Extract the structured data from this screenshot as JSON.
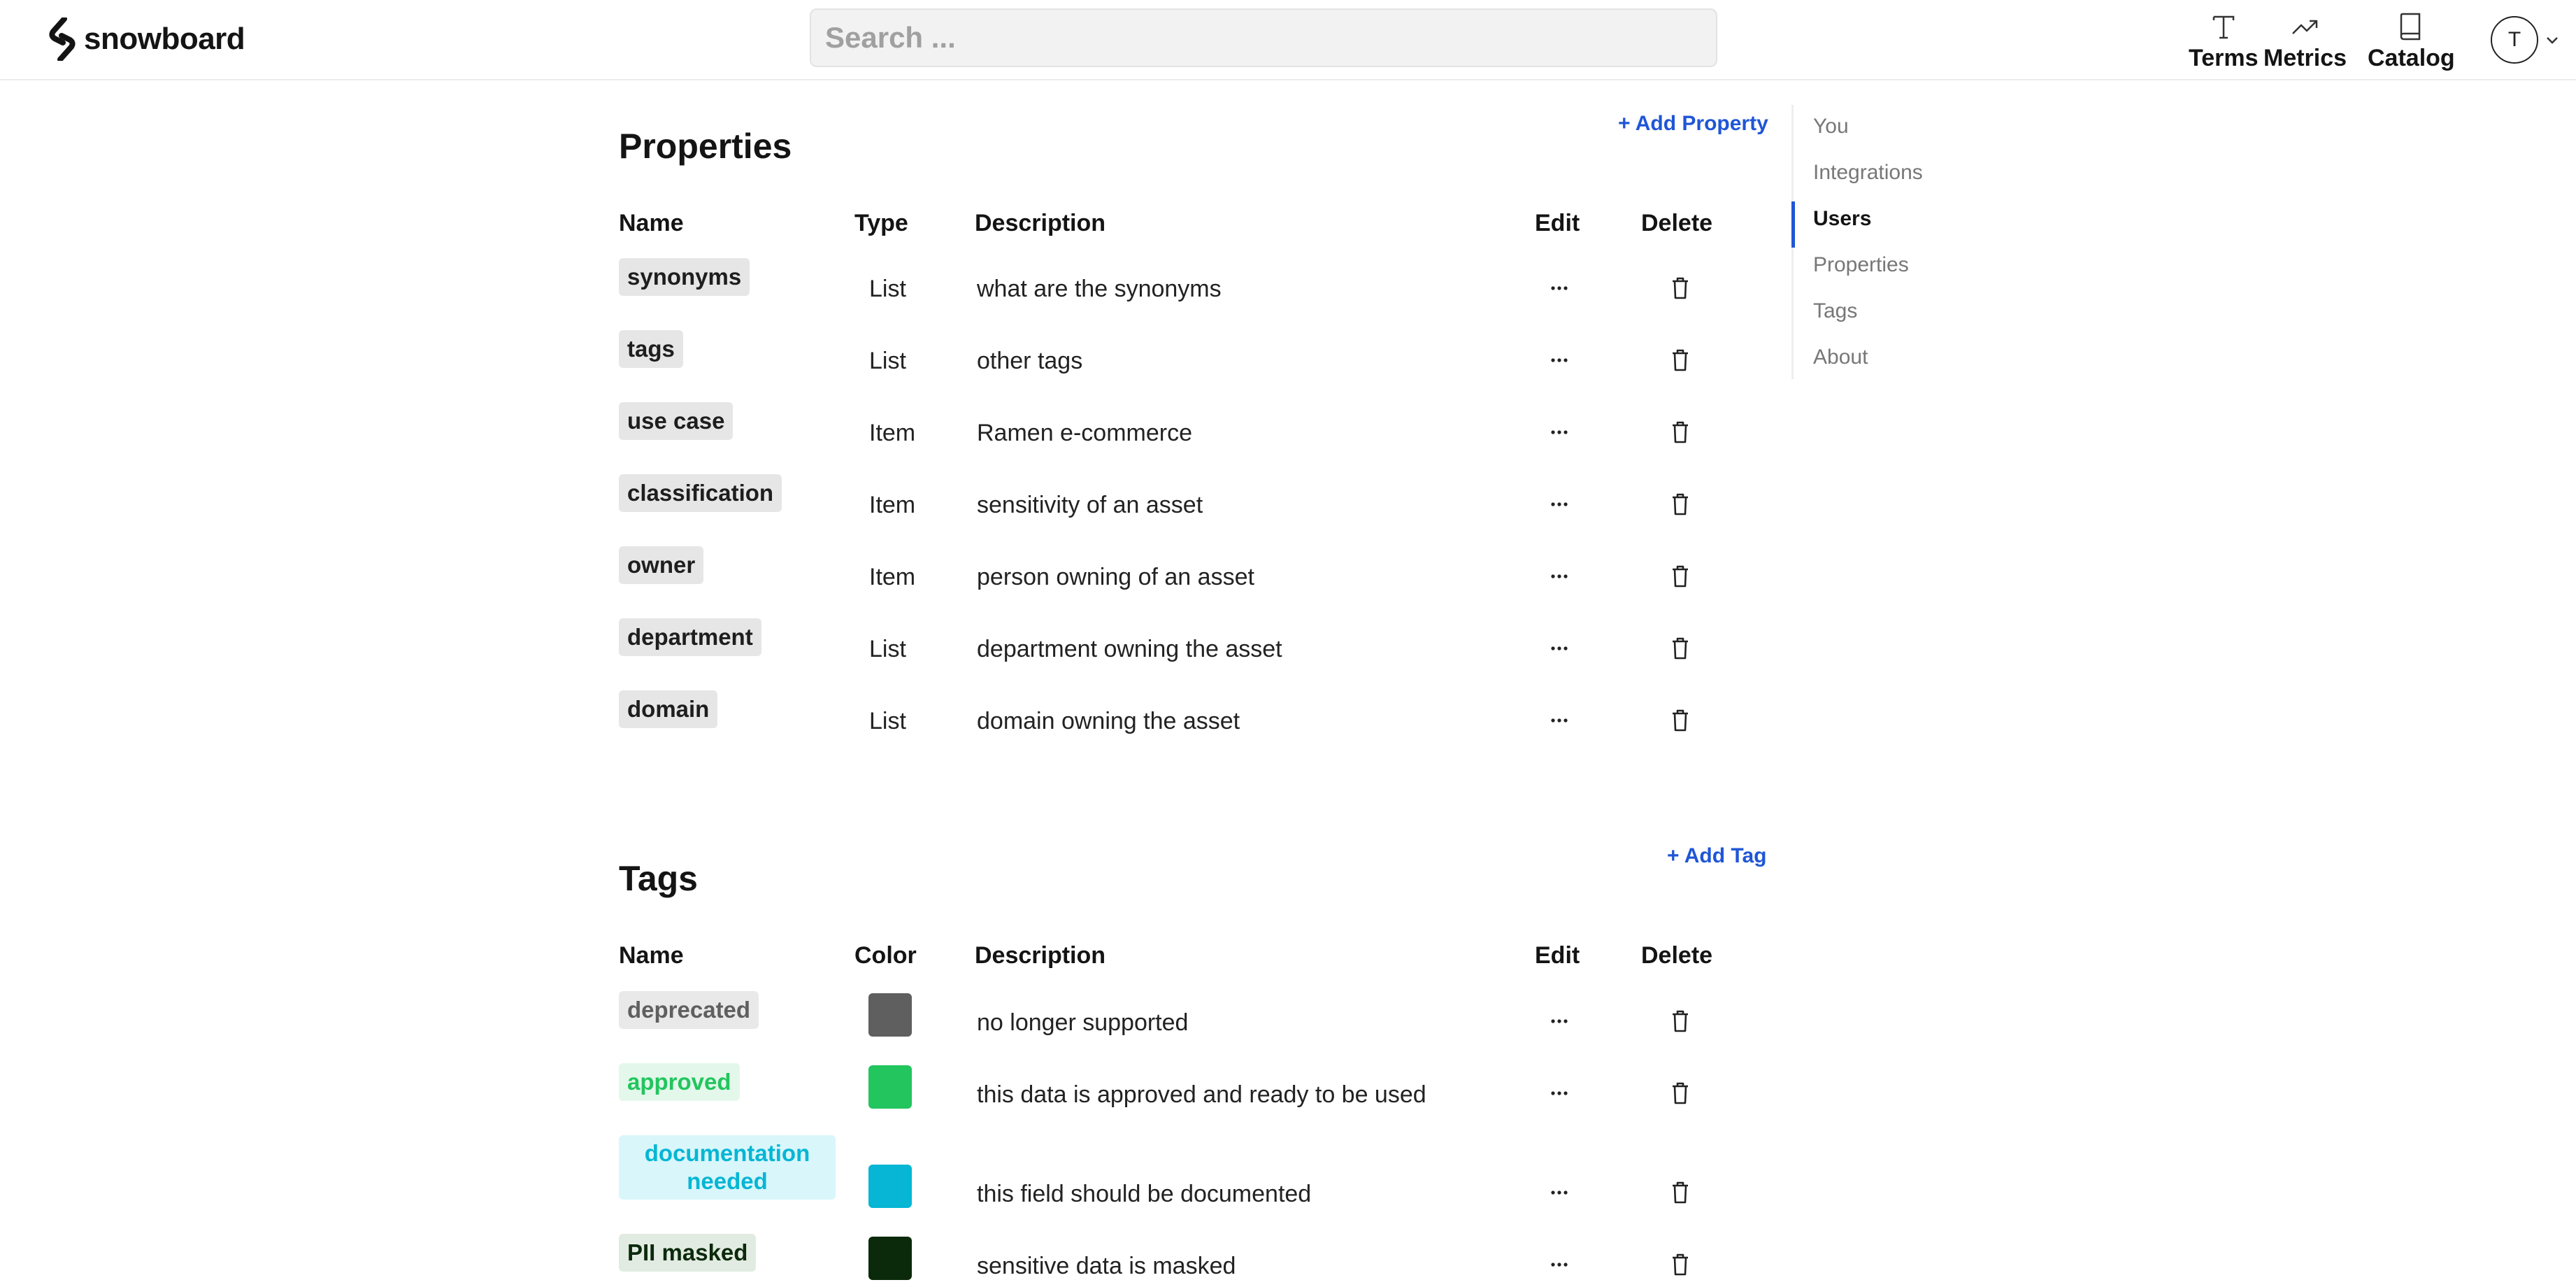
{
  "app": {
    "name": "snowboard"
  },
  "search": {
    "placeholder": "Search ..."
  },
  "nav": {
    "terms": "Terms",
    "metrics": "Metrics",
    "catalog": "Catalog"
  },
  "user": {
    "initial": "T"
  },
  "toc": {
    "items": [
      "You",
      "Integrations",
      "Users",
      "Properties",
      "Tags",
      "About"
    ],
    "active": "Users"
  },
  "properties": {
    "title": "Properties",
    "add_label": "Add Property",
    "headers": {
      "name": "Name",
      "type": "Type",
      "description": "Description",
      "edit": "Edit",
      "delete": "Delete"
    },
    "rows": [
      {
        "name": "synonyms",
        "type": "List",
        "description": "what are the synonyms"
      },
      {
        "name": "tags",
        "type": "List",
        "description": "other tags"
      },
      {
        "name": "use case",
        "type": "Item",
        "description": "Ramen e-commerce"
      },
      {
        "name": "classification",
        "type": "Item",
        "description": "sensitivity of an asset"
      },
      {
        "name": "owner",
        "type": "Item",
        "description": "person owning of an asset"
      },
      {
        "name": "department",
        "type": "List",
        "description": "department owning the asset"
      },
      {
        "name": "domain",
        "type": "List",
        "description": "domain owning the asset"
      }
    ]
  },
  "tags": {
    "title": "Tags",
    "add_label": "Add Tag",
    "headers": {
      "name": "Name",
      "color": "Color",
      "description": "Description",
      "edit": "Edit",
      "delete": "Delete"
    },
    "rows": [
      {
        "name": "deprecated",
        "color": "#5f5f5f",
        "pill_bg": "#e9e9e9",
        "pill_fg": "#5f5f5f",
        "description": "no longer supported"
      },
      {
        "name": "approved",
        "color": "#22c55e",
        "pill_bg": "#e3f8ea",
        "pill_fg": "#22c55e",
        "description": "this data is approved and ready to be used"
      },
      {
        "name": "documentation needed",
        "color": "#06b6d4",
        "pill_bg": "#d9f6fb",
        "pill_fg": "#06b6d4",
        "description": "this field should be documented"
      },
      {
        "name": "PII masked",
        "color": "#0b2a0b",
        "pill_bg": "#e2ebe2",
        "pill_fg": "#0b2a0b",
        "description": "sensitive data is masked"
      }
    ]
  },
  "colors": {
    "accent": "#1f56d6",
    "text": "#141414",
    "muted": "#777777"
  },
  "icons": {
    "terms": "text-T-icon",
    "metrics": "trend-icon",
    "catalog": "book-icon",
    "edit": "more-dots-icon",
    "delete": "trash-icon",
    "chevron": "chevron-down-icon"
  }
}
